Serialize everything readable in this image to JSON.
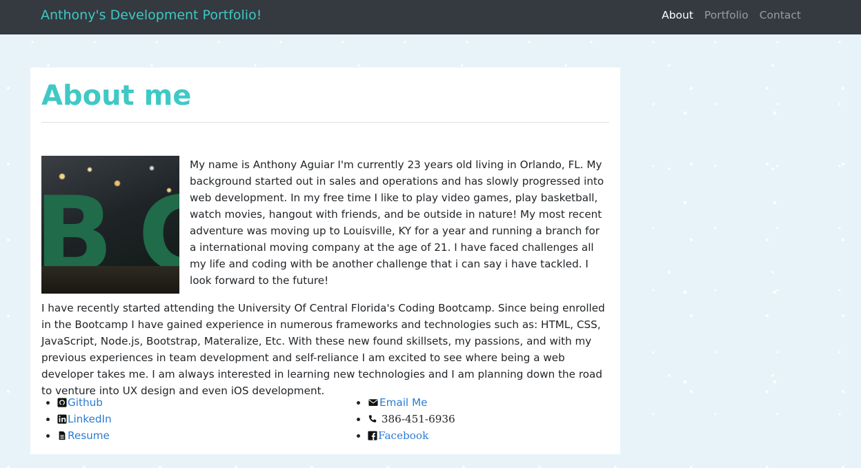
{
  "navbar": {
    "brand": "Anthony's Development Portfolio!",
    "links": [
      {
        "label": "About",
        "active": true
      },
      {
        "label": "Portfolio",
        "active": false
      },
      {
        "label": "Contact",
        "active": false
      }
    ]
  },
  "about": {
    "title": "About me",
    "paragraphs": [
      "My name is Anthony Aguiar I'm currently 23 years old living in Orlando, FL. My background started out in sales and operations and has slowly progressed into web development. In my free time I like to play video games, play basketball, watch movies, hangout with friends, and be outside in nature! My most recent adventure was moving up to Louisville, KY for a year and running a branch for a international moving company at the age of 21. I have faced challenges all my life and coding with be another challenge that i can say i have tackled. I look forward to the future!",
      "I have recently started attending the University Of Central Florida's Coding Bootcamp. Since being enrolled in the Bootcamp I have gained experience in numerous frameworks and technologies such as: HTML, CSS, JavaScript, Node.js, Bootstrap, Materalize, Etc. With these new found skillsets, my passions, and with my previous experiences in team development and self-reliance I am excited to see where being a web developer takes me. I am always interested in learning new technologies and I am planning down the road to venture into UX design and even iOS development."
    ]
  },
  "links_left": [
    {
      "label": "Github",
      "icon": "github-icon"
    },
    {
      "label": "LinkedIn",
      "icon": "linkedin-icon"
    },
    {
      "label": "Resume",
      "icon": "file-icon"
    }
  ],
  "links_right": [
    {
      "label": "Email Me",
      "icon": "envelope-icon"
    },
    {
      "label": "386-451-6936",
      "icon": "phone-icon"
    },
    {
      "label": "Facebook",
      "icon": "facebook-icon"
    }
  ],
  "colors": {
    "accent": "#3ec9c5",
    "navbar_bg": "#343a40",
    "link": "#2a7bd3",
    "page_bg": "#e8f3f9"
  }
}
